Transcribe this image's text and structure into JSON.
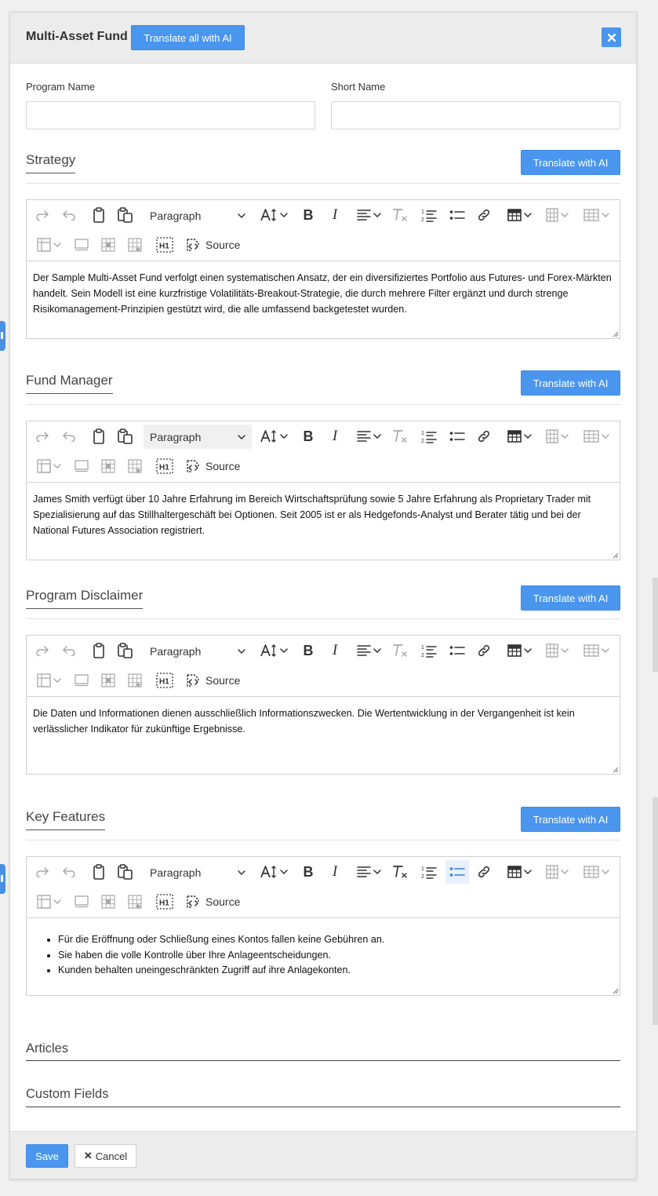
{
  "header": {
    "title": "Multi-Asset Fund",
    "translate_all_label": "Translate all with AI",
    "close_icon": "close-icon"
  },
  "fields": {
    "program_name_label": "Program Name",
    "program_name_value": "",
    "short_name_label": "Short Name",
    "short_name_value": ""
  },
  "toolbar": {
    "paragraph_label": "Paragraph",
    "source_label": "Source",
    "icons": [
      "redo-icon",
      "undo-icon",
      "paste-icon",
      "paste-plain-icon",
      "font-size-icon",
      "bold-icon",
      "italic-icon",
      "align-icon",
      "remove-format-icon",
      "numbered-list-icon",
      "bulleted-list-icon",
      "link-icon",
      "table-icon",
      "table-column-icon",
      "table-row-icon",
      "merge-cells-icon",
      "table-properties-icon",
      "cell-properties-icon",
      "table-cell-style-icon",
      "heading-icon",
      "source-icon"
    ]
  },
  "sections": [
    {
      "title": "Strategy",
      "translate_label": "Translate with AI",
      "content": "Der Sample Multi-Asset Fund verfolgt einen systematischen Ansatz, der ein diversifiziertes Portfolio aus Futures- und Forex-Märkten handelt. Sein Modell ist eine kurzfristige Volatilitäts-Breakout-Strategie, die durch mehrere Filter ergänzt und durch strenge Risikomanagement-Prinzipien gestützt wird, die alle umfassend backgetestet wurden."
    },
    {
      "title": "Fund Manager",
      "translate_label": "Translate with AI",
      "content": "James Smith verfügt über 10 Jahre Erfahrung im Bereich Wirtschaftsprüfung sowie 5 Jahre Erfahrung als Proprietary Trader mit Spezialisierung auf das Stillhaltergeschäft bei Optionen. Seit 2005 ist er als Hedgefonds-Analyst und Berater tätig und bei der National Futures Association registriert."
    },
    {
      "title": "Program Disclaimer",
      "translate_label": "Translate with AI",
      "content": "Die Daten und Informationen dienen ausschließlich Informationszwecken. Die Wertentwicklung in der Vergangenheit ist kein verlässlicher Indikator für zukünftige Ergebnisse."
    },
    {
      "title": "Key Features",
      "translate_label": "Translate with AI",
      "items": [
        "Für die Eröffnung oder Schließung eines Kontos fallen keine Gebühren an.",
        "Sie haben die volle Kontrolle über Ihre Anlageentscheidungen.",
        "Kunden behalten uneingeschränkten Zugriff auf ihre Anlagekonten."
      ]
    }
  ],
  "extra_sections": {
    "articles": "Articles",
    "custom_fields": "Custom Fields"
  },
  "footer": {
    "save_label": "Save",
    "cancel_label": "Cancel"
  },
  "colors": {
    "accent": "#4a96ee",
    "header_bg": "#ececec"
  }
}
